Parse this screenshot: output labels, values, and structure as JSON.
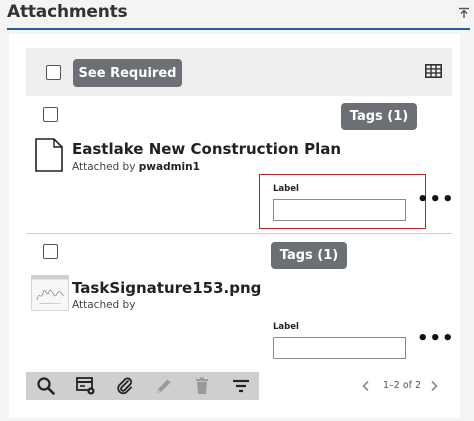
{
  "panel": {
    "title": "Attachments"
  },
  "toolbar": {
    "see_required_label": "See Required"
  },
  "items": [
    {
      "tags_label": "Tags (1)",
      "name": "Eastlake New Construction Plan",
      "attached_by_prefix": "Attached by",
      "attached_by_user": "pwadmin1",
      "field_label": "Label",
      "field_value": "",
      "more_label": "•••"
    },
    {
      "tags_label": "Tags (1)",
      "name": "TaskSignature153.png",
      "attached_by_prefix": "Attached by",
      "attached_by_user": "",
      "field_label": "Label",
      "field_value": "",
      "more_label": "•••"
    }
  ],
  "pager": {
    "text": "1–2 of 2"
  },
  "icons": {
    "collapse": "collapse-up-icon",
    "grid": "grid-view-icon",
    "document": "document-icon",
    "thumbnail": "image-thumbnail-icon",
    "search": "search-icon",
    "scan": "scan-icon",
    "attach": "paperclip-icon",
    "edit": "pencil-icon",
    "delete": "trash-icon",
    "filter": "filter-icon",
    "prev": "chevron-left-icon",
    "next": "chevron-right-icon"
  },
  "colors": {
    "accent": "#2d5aa0",
    "button": "#6c6f73",
    "highlight": "#b3262a"
  }
}
